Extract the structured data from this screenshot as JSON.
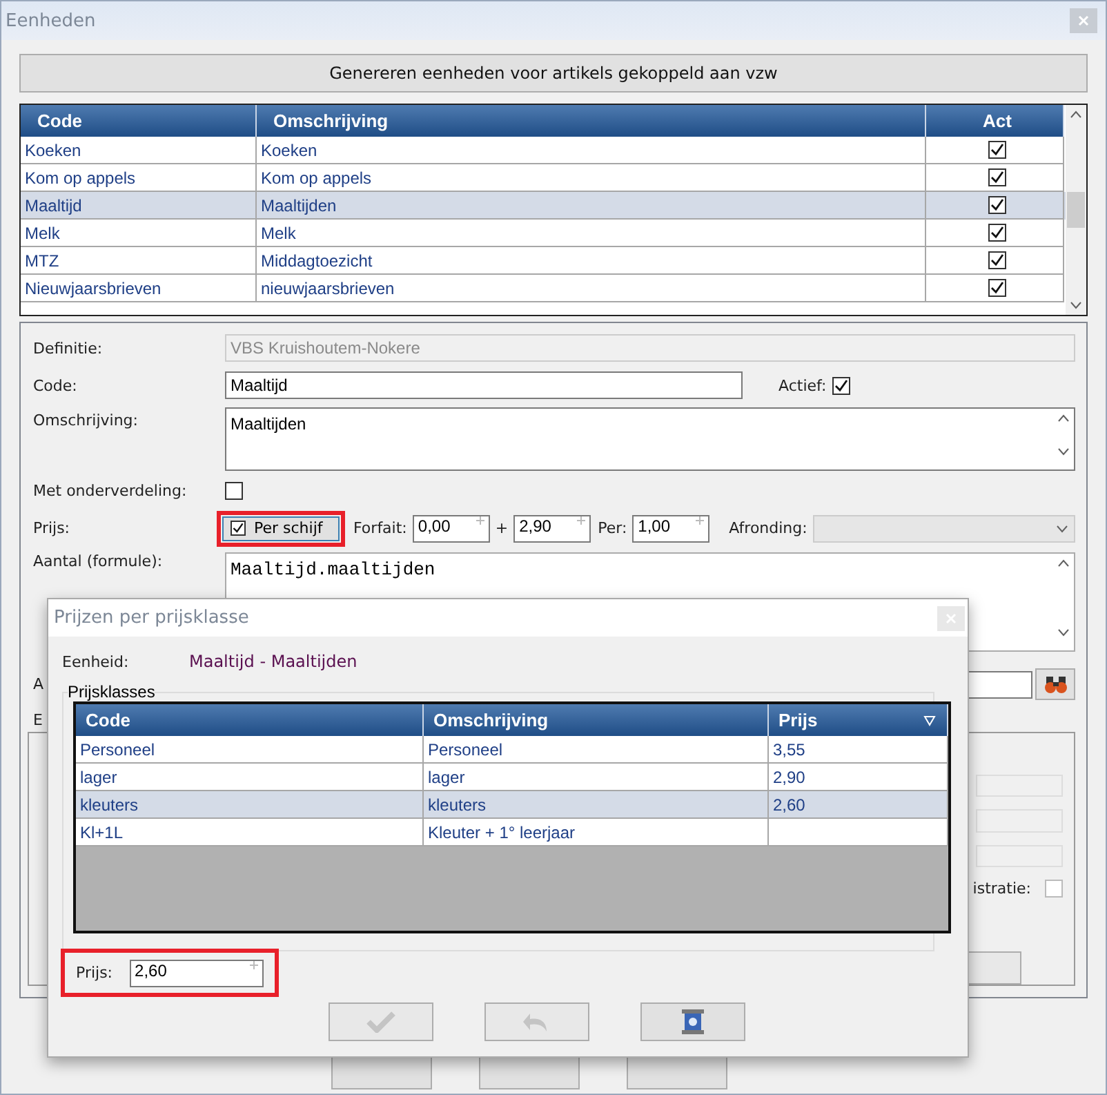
{
  "window": {
    "title": "Eenheden"
  },
  "generate_button": "Genereren eenheden voor artikels gekoppeld aan vzw",
  "units_table": {
    "columns": [
      "Code",
      "Omschrijving",
      "Act"
    ],
    "rows": [
      {
        "code": "Koeken",
        "description": "Koeken",
        "active": true,
        "selected": false
      },
      {
        "code": "Kom op appels",
        "description": "Kom op appels",
        "active": true,
        "selected": false
      },
      {
        "code": "Maaltijd",
        "description": "Maaltijden",
        "active": true,
        "selected": true
      },
      {
        "code": "Melk",
        "description": "Melk",
        "active": true,
        "selected": false
      },
      {
        "code": "MTZ",
        "description": "Middagtoezicht",
        "active": true,
        "selected": false
      },
      {
        "code": "Nieuwjaarsbrieven",
        "description": "nieuwjaarsbrieven",
        "active": true,
        "selected": false
      }
    ]
  },
  "form": {
    "definitie": {
      "label": "Definitie:",
      "value": "VBS Kruishoutem-Nokere",
      "disabled": true
    },
    "code": {
      "label": "Code:",
      "value": "Maaltijd"
    },
    "actief": {
      "label": "Actief:",
      "checked": true
    },
    "omschrijving": {
      "label": "Omschrijving:",
      "value": "Maaltijden"
    },
    "met_onderverdeling": {
      "label": "Met onderverdeling:",
      "checked": false
    },
    "prijs": {
      "label": "Prijs:",
      "per_schijf": {
        "label": "Per schijf",
        "checked": true
      },
      "forfait_label": "Forfait:",
      "forfait": "0,00",
      "plus": "+",
      "amount": "2,90",
      "per_label": "Per:",
      "per": "1,00",
      "afronding_label": "Afronding:"
    },
    "aantal": {
      "label": "Aantal (formule):",
      "value": "Maaltijd.maaltijden"
    },
    "label_a": "A",
    "label_e": "E",
    "registratie": {
      "label": "istratie:",
      "checked": false
    }
  },
  "popup": {
    "title": "Prijzen per prijsklasse",
    "eenheid_label": "Eenheid:",
    "eenheid": "Maaltijd - Maaltijden",
    "group_title": "Prijsklasses",
    "columns": [
      "Code",
      "Omschrijving",
      "Prijs"
    ],
    "rows": [
      {
        "code": "Personeel",
        "description": "Personeel",
        "price": "3,55",
        "selected": false
      },
      {
        "code": "lager",
        "description": "lager",
        "price": "2,90",
        "selected": false
      },
      {
        "code": "kleuters",
        "description": "kleuters",
        "price": "2,60",
        "selected": true
      },
      {
        "code": "Kl+1L",
        "description": "Kleuter + 1° leerjaar",
        "price": "",
        "selected": false
      }
    ],
    "prijs_label": "Prijs:",
    "prijs": "2,60",
    "buttons": [
      {
        "kind": "confirm",
        "disabled": true
      },
      {
        "kind": "undo",
        "disabled": true
      },
      {
        "kind": "clear",
        "disabled": false
      }
    ]
  }
}
